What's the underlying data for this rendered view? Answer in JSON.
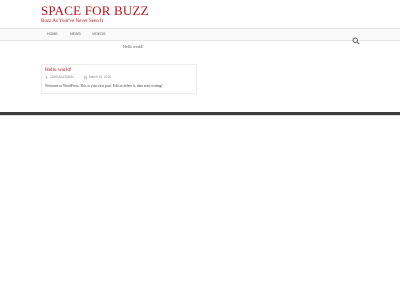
{
  "site": {
    "title": "SPACE FOR BUZZ",
    "tagline": "Buzz As Your've Never Seen It"
  },
  "nav": {
    "items": [
      "HOME",
      "NEWS",
      "VIDEOS"
    ],
    "search_icon": "search-icon"
  },
  "ticker": {
    "text": "Hello world!"
  },
  "post": {
    "title": "Hello world!",
    "author": "ZAHSANZIQBAL",
    "date": "March 16, 2018",
    "excerpt": "Welcome to WordPress. This is your first post. Edit or delete it, then start writing!",
    "author_icon": "user-icon",
    "date_icon": "calendar-icon"
  },
  "colors": {
    "brand": "#b8141a",
    "footer": "#3c3c3c"
  }
}
